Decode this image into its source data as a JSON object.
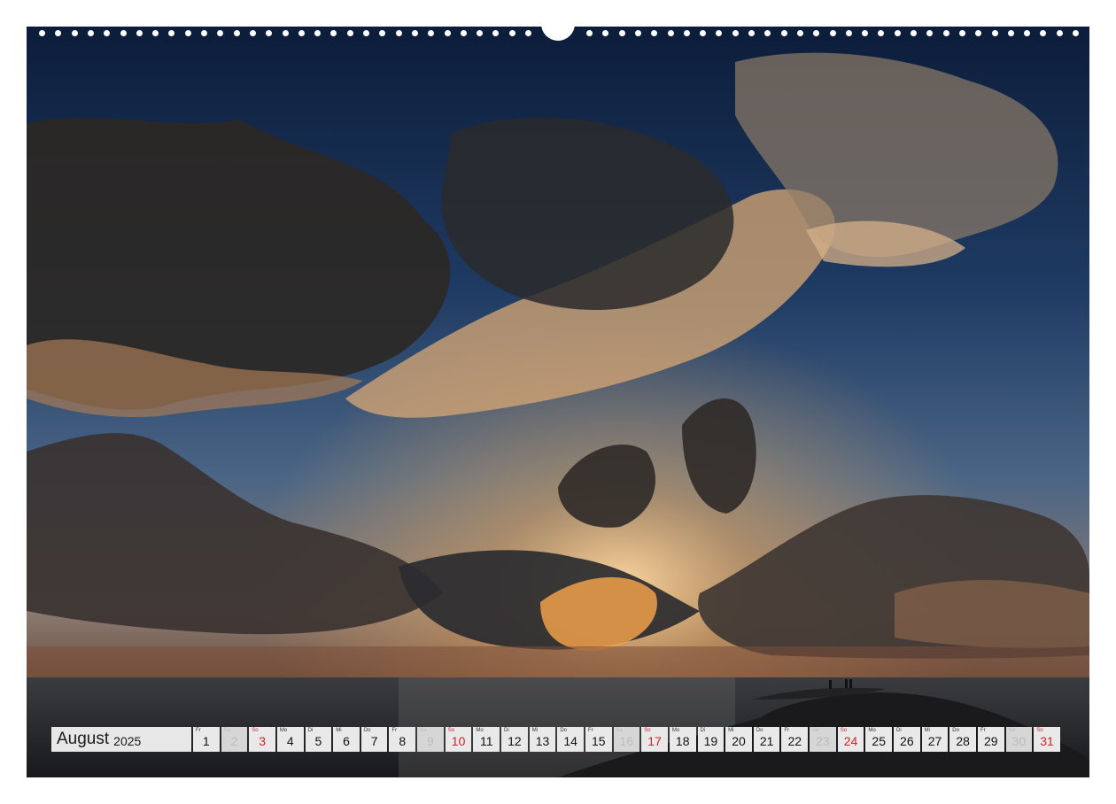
{
  "calendar": {
    "month": "August",
    "year": "2025",
    "days": [
      {
        "wd": "Fr",
        "num": "1",
        "type": "normal"
      },
      {
        "wd": "Sa",
        "num": "2",
        "type": "holiday"
      },
      {
        "wd": "So",
        "num": "3",
        "type": "sunday"
      },
      {
        "wd": "Mo",
        "num": "4",
        "type": "normal"
      },
      {
        "wd": "Di",
        "num": "5",
        "type": "normal"
      },
      {
        "wd": "Mi",
        "num": "6",
        "type": "normal"
      },
      {
        "wd": "Do",
        "num": "7",
        "type": "normal"
      },
      {
        "wd": "Fr",
        "num": "8",
        "type": "normal"
      },
      {
        "wd": "Sa",
        "num": "9",
        "type": "holiday"
      },
      {
        "wd": "So",
        "num": "10",
        "type": "sunday"
      },
      {
        "wd": "Mo",
        "num": "11",
        "type": "normal"
      },
      {
        "wd": "Di",
        "num": "12",
        "type": "normal"
      },
      {
        "wd": "Mi",
        "num": "13",
        "type": "normal"
      },
      {
        "wd": "Do",
        "num": "14",
        "type": "normal"
      },
      {
        "wd": "Fr",
        "num": "15",
        "type": "normal"
      },
      {
        "wd": "Sa",
        "num": "16",
        "type": "holiday"
      },
      {
        "wd": "So",
        "num": "17",
        "type": "sunday"
      },
      {
        "wd": "Mo",
        "num": "18",
        "type": "normal"
      },
      {
        "wd": "Di",
        "num": "19",
        "type": "normal"
      },
      {
        "wd": "Mi",
        "num": "20",
        "type": "normal"
      },
      {
        "wd": "Do",
        "num": "21",
        "type": "normal"
      },
      {
        "wd": "Fr",
        "num": "22",
        "type": "normal"
      },
      {
        "wd": "Sa",
        "num": "23",
        "type": "holiday"
      },
      {
        "wd": "So",
        "num": "24",
        "type": "sunday"
      },
      {
        "wd": "Mo",
        "num": "25",
        "type": "normal"
      },
      {
        "wd": "Di",
        "num": "26",
        "type": "normal"
      },
      {
        "wd": "Mi",
        "num": "27",
        "type": "normal"
      },
      {
        "wd": "Do",
        "num": "28",
        "type": "normal"
      },
      {
        "wd": "Fr",
        "num": "29",
        "type": "normal"
      },
      {
        "wd": "Sa",
        "num": "30",
        "type": "holiday"
      },
      {
        "wd": "So",
        "num": "31",
        "type": "sunday"
      }
    ]
  },
  "colors": {
    "sky_top": "#0f2240",
    "sky_mid": "#2b4a6e",
    "horizon_glow": "#e0a45e",
    "sunday_red": "#d3202a"
  }
}
